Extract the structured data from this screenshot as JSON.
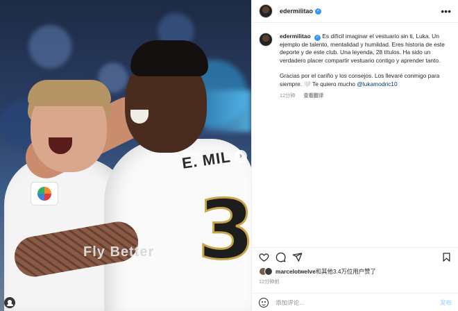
{
  "photo": {
    "jersey_name": "E. MIL",
    "jersey_number": "3",
    "sponsor": "Fly Better",
    "next_icon": "chevron-right-icon",
    "tag_icon": "user-tag-icon"
  },
  "header": {
    "username": "edermilitao",
    "verified_icon": "verified-badge-icon",
    "more_icon": "more-horizontal-icon",
    "more_label": "•••"
  },
  "caption": {
    "username": "edermilitao",
    "paragraph1": "Es difícil imaginar el vestuario sin ti, Luka. Un ejemplo de talento, mentalidad y humildad. Eres historia de este deporte y de este club. Una leyenda, 28 títulos. Ha sido un verdadero placer compartir vestuario contigo y aprender tanto.",
    "paragraph2_text": "Gracias por el cariño y los consejos. Los llevaré conmigo para siempre. 🤍 Te quiero mucho ",
    "mention": "@lukamodric10",
    "time_ago": "12分钟",
    "see_translation": "查看翻译"
  },
  "actions": {
    "like_icon": "heart-icon",
    "comment_icon": "comment-icon",
    "share_icon": "send-icon",
    "save_icon": "bookmark-icon"
  },
  "likes": {
    "user": "marcelotwelve",
    "suffix": "和其他3.4万位用户赞了"
  },
  "post_time": "12分钟前",
  "comment_bar": {
    "emoji_icon": "emoji-icon",
    "placeholder": "添加评论...",
    "post_label": "发布"
  },
  "colors": {
    "verified": "#3897f0",
    "mention": "#00376b",
    "post_button_disabled": "#b3dbff",
    "secondary_text": "#8e8e8e"
  }
}
